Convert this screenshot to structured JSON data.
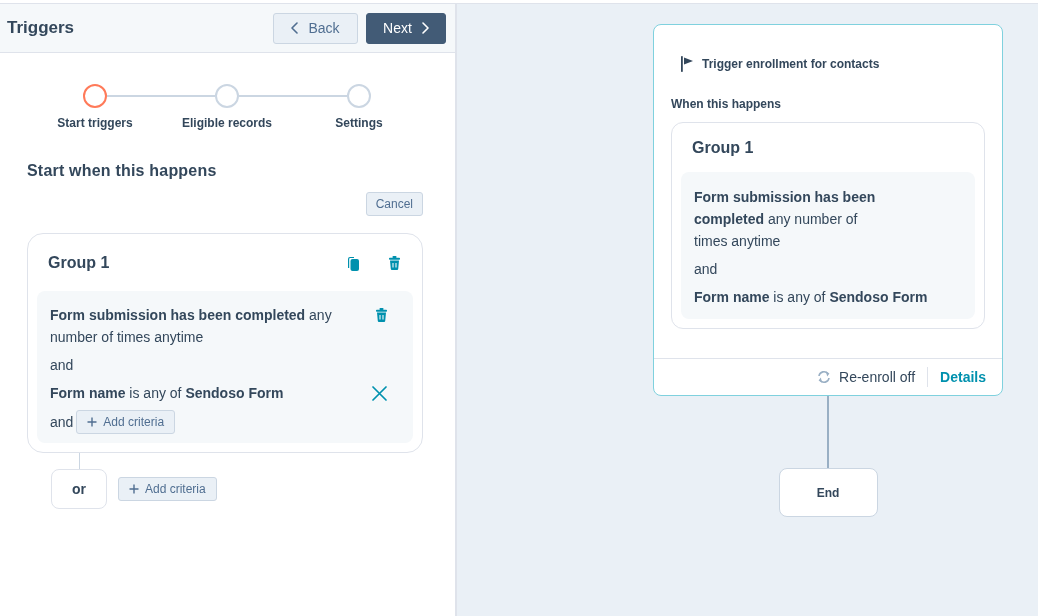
{
  "panel": {
    "title": "Triggers",
    "back_button": "Back",
    "next_button": "Next"
  },
  "steps": [
    {
      "label": "Start triggers",
      "selected": true
    },
    {
      "label": "Eligible records",
      "selected": false
    },
    {
      "label": "Settings",
      "selected": false
    }
  ],
  "section_title": "Start when this happens",
  "cancel_button": "Cancel",
  "group": {
    "title": "Group 1",
    "criteria": [
      {
        "kind": "event",
        "text": "**Form submission has been completed** any number of times anytime"
      },
      {
        "kind": "connector",
        "text": "and"
      },
      {
        "kind": "refinement",
        "text": "**Form name** is any of **Sendoso Form**"
      }
    ],
    "add_connector": "and",
    "add_button": "Add criteria"
  },
  "or_label": "or",
  "add_group_button": "Add criteria",
  "canvas": {
    "trigger_card": {
      "title": "Trigger enrollment for contacts",
      "subtitle": "When this happens",
      "group": {
        "title": "Group 1",
        "criteria": [
          {
            "kind": "event",
            "text": "**Form submission has been completed** any number of times anytime"
          },
          {
            "kind": "connector",
            "text": "and"
          },
          {
            "kind": "refinement",
            "text": "**Form name** is any of **Sendoso Form**"
          }
        ]
      },
      "reenroll": "Re-enroll off",
      "details_link": "Details"
    },
    "end_node": "End"
  }
}
